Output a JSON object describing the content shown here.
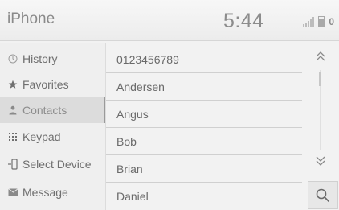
{
  "header": {
    "title": "iPhone",
    "time": "5:44",
    "bt_count": "0"
  },
  "sidebar": {
    "items": [
      {
        "label": "History",
        "icon": "clock-icon",
        "active": false
      },
      {
        "label": "Favorites",
        "icon": "star-icon",
        "active": false
      },
      {
        "label": "Contacts",
        "icon": "person-icon",
        "active": true
      },
      {
        "label": "Keypad",
        "icon": "keypad-icon",
        "active": false
      },
      {
        "label": "Select Device",
        "icon": "phone-device-icon",
        "active": false
      },
      {
        "label": "Message",
        "icon": "envelope-icon",
        "active": false
      }
    ]
  },
  "contacts": {
    "rows": [
      "0123456789",
      "Andersen",
      "Angus",
      "Bob",
      "Brian",
      "Daniel"
    ]
  },
  "colors": {
    "background": "#f2f2f2",
    "text": "#6a6a6a",
    "active_item": "#dcdcdc"
  }
}
